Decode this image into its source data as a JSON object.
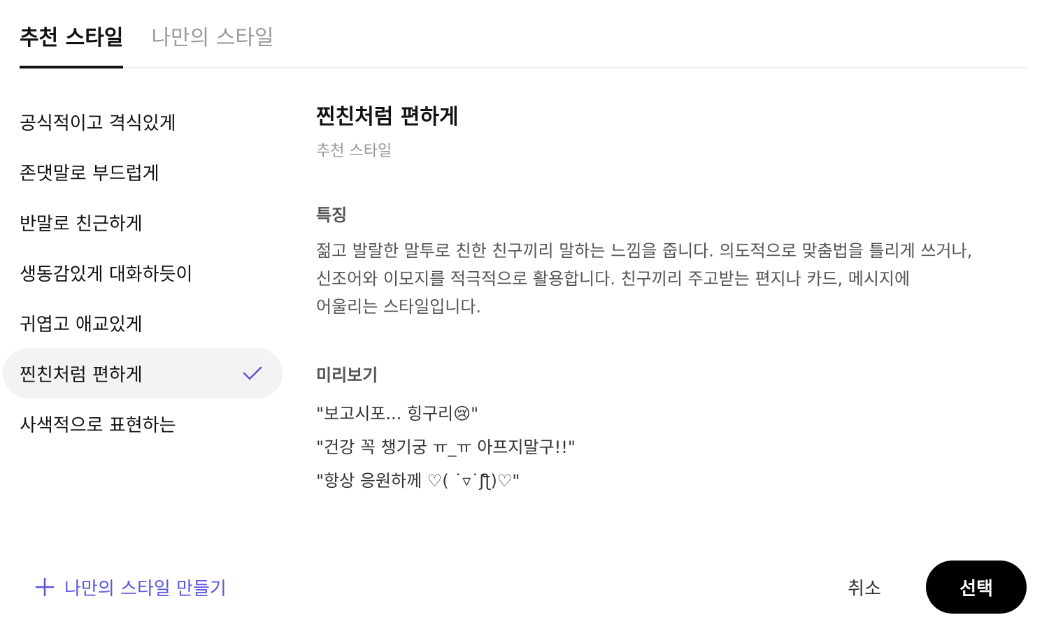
{
  "tabs": [
    {
      "label": "추천 스타일",
      "active": true
    },
    {
      "label": "나만의 스타일",
      "active": false
    }
  ],
  "styles": [
    {
      "label": "공식적이고 격식있게",
      "selected": false
    },
    {
      "label": "존댓말로 부드럽게",
      "selected": false
    },
    {
      "label": "반말로 친근하게",
      "selected": false
    },
    {
      "label": "생동감있게 대화하듯이",
      "selected": false
    },
    {
      "label": "귀엽고 애교있게",
      "selected": false
    },
    {
      "label": "찐친처럼 편하게",
      "selected": true,
      "icon": "check-icon"
    },
    {
      "label": "사색적으로 표현하는",
      "selected": false
    }
  ],
  "detail": {
    "title": "찐친처럼 편하게",
    "subtitle": "추천 스타일",
    "features_heading": "특징",
    "features_lines": [
      "젊고 발랄한 말투로 친한 친구끼리 말하는 느낌을 줍니다. 의도적으로 맞춤법을 틀리게 쓰거나,",
      "신조어와 이모지를 적극적으로 활용합니다. 친구끼리 주고받는 편지나 카드, 메시지에",
      "어울리는 스타일입니다."
    ],
    "preview_heading": "미리보기",
    "preview_lines": [
      "\"보고시포... 힝구리😢\"",
      "\"건강 꼭 챙기궁 ㅠ_ㅠ 아프지말구!!\"",
      "\"항상 응원하께 ♡( ˙▿˙ʃƪ)♡\""
    ]
  },
  "footer": {
    "create_label": "나만의 스타일 만들기",
    "create_icon": "plus-icon",
    "cancel_label": "취소",
    "select_label": "선택"
  },
  "colors": {
    "accent": "#5b57e0",
    "primary_button": "#000000",
    "selected_row": "#f3f3f3",
    "muted_text": "#9a9a9a"
  }
}
